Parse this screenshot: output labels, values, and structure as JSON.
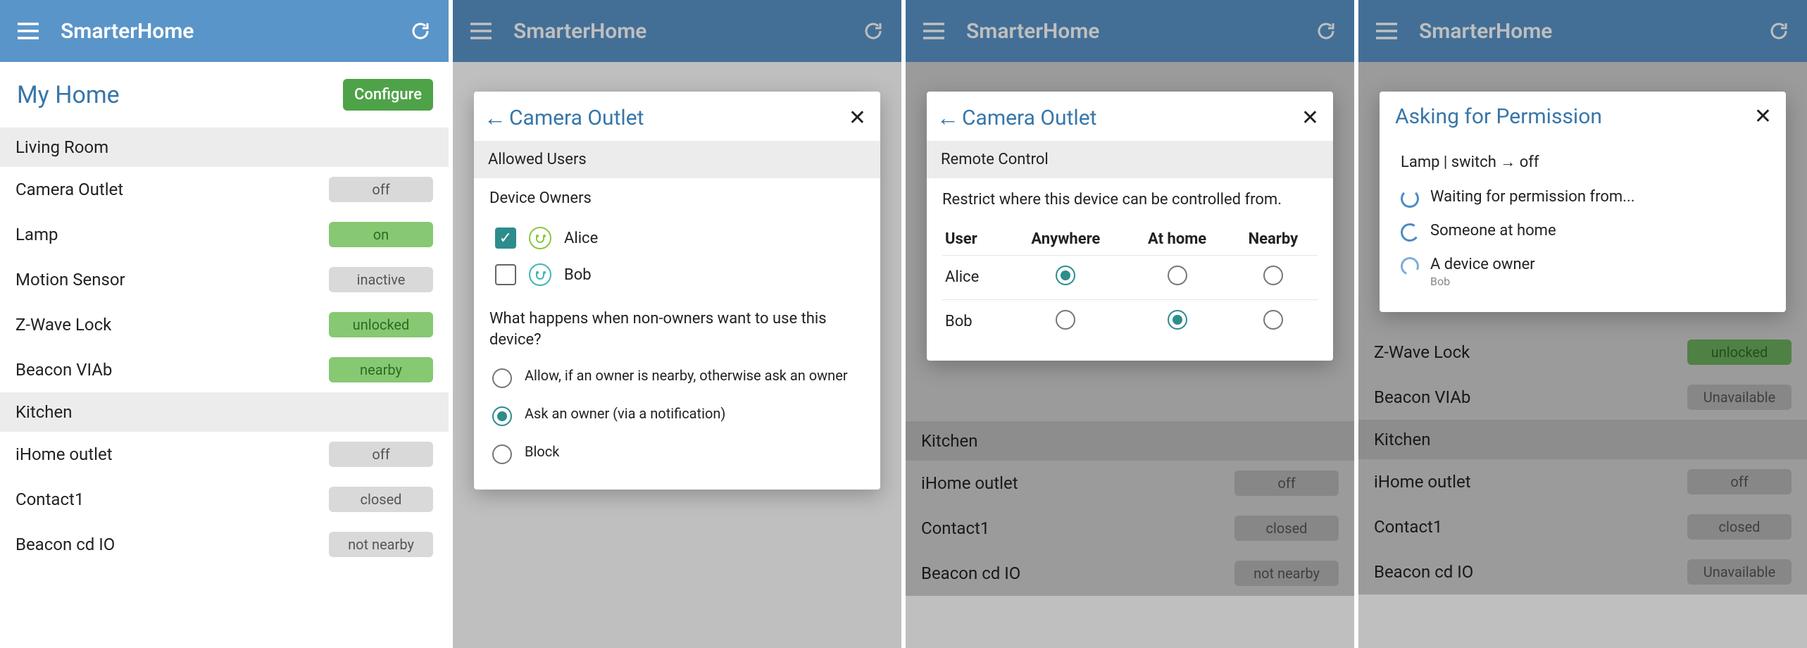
{
  "app_title": "SmarterHome",
  "screens": {
    "a": {
      "header": {
        "title": "My Home",
        "configure": "Configure"
      },
      "sections": [
        {
          "name": "Living Room",
          "rows": [
            {
              "label": "Camera Outlet",
              "status": "off",
              "style": "grey"
            },
            {
              "label": "Lamp",
              "status": "on",
              "style": "green"
            },
            {
              "label": "Motion Sensor",
              "status": "inactive",
              "style": "grey"
            },
            {
              "label": "Z-Wave Lock",
              "status": "unlocked",
              "style": "green"
            },
            {
              "label": "Beacon VIAb",
              "status": "nearby",
              "style": "green"
            }
          ]
        },
        {
          "name": "Kitchen",
          "rows": [
            {
              "label": "iHome outlet",
              "status": "off",
              "style": "grey"
            },
            {
              "label": "Contact1",
              "status": "closed",
              "style": "grey"
            },
            {
              "label": "Beacon cd IO",
              "status": "not nearby",
              "style": "grey"
            }
          ]
        }
      ]
    },
    "b": {
      "dialog": {
        "title": "Camera Outlet",
        "section": "Allowed Users",
        "owners_label": "Device Owners",
        "owners": [
          {
            "name": "Alice",
            "checked": true,
            "avatar": "green"
          },
          {
            "name": "Bob",
            "checked": false,
            "avatar": "teal"
          }
        ],
        "question": "What happens when non-owners want to use this device?",
        "options": [
          {
            "label": "Allow, if an owner is nearby, otherwise ask an owner",
            "selected": false
          },
          {
            "label": "Ask an owner (via a notification)",
            "selected": true
          },
          {
            "label": "Block",
            "selected": false
          }
        ]
      }
    },
    "c": {
      "dialog": {
        "title": "Camera Outlet",
        "section": "Remote Control",
        "desc": "Restrict where this device can be controlled from.",
        "cols": [
          "User",
          "Anywhere",
          "At home",
          "Nearby"
        ],
        "rows": [
          {
            "user": "Alice",
            "sel": 0
          },
          {
            "user": "Bob",
            "sel": 1
          }
        ]
      },
      "bg_rows": [
        {
          "section": "Kitchen"
        },
        {
          "label": "iHome outlet",
          "status": "off",
          "style": "grey"
        },
        {
          "label": "Contact1",
          "status": "closed",
          "style": "grey"
        },
        {
          "label": "Beacon cd IO",
          "status": "not nearby",
          "style": "grey"
        }
      ]
    },
    "d": {
      "dialog": {
        "title": "Asking for Permission",
        "action": "Lamp | switch → off",
        "items": [
          {
            "text": "Waiting for permission from..."
          },
          {
            "text": "Someone at home"
          },
          {
            "text": "A device owner",
            "sub": "Bob"
          }
        ]
      },
      "bg_rows": [
        {
          "label": "Z-Wave Lock",
          "status": "unlocked",
          "style": "green"
        },
        {
          "label": "Beacon VIAb",
          "status": "Unavailable",
          "style": "greydark"
        },
        {
          "section": "Kitchen"
        },
        {
          "label": "iHome outlet",
          "status": "off",
          "style": "grey"
        },
        {
          "label": "Contact1",
          "status": "closed",
          "style": "grey"
        },
        {
          "label": "Beacon cd IO",
          "status": "Unavailable",
          "style": "greydark"
        }
      ]
    }
  }
}
